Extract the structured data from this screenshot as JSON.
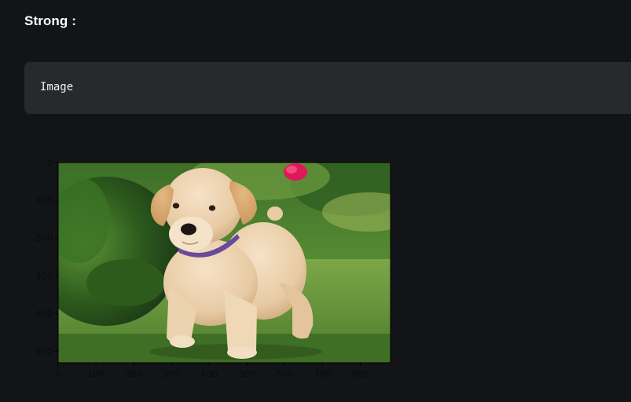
{
  "section": {
    "heading": "Strong :"
  },
  "code_block": {
    "text": "Image"
  },
  "plot": {
    "image_subject": "labrador-puppy-on-grass",
    "y_ticks": [
      "0",
      "100",
      "200",
      "300",
      "400",
      "500"
    ],
    "x_ticks": [
      "0",
      "100",
      "200",
      "300",
      "400",
      "500",
      "600",
      "700",
      "800"
    ],
    "colors": {
      "background": "#131417",
      "code_block": "#28292d",
      "tick_text": "#0b0b0b"
    }
  }
}
